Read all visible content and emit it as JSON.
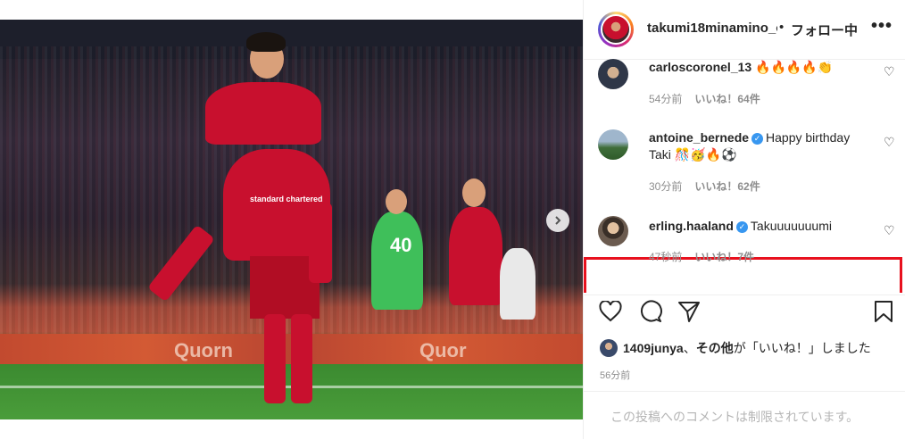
{
  "post": {
    "author": "takumi18minamino_o",
    "separator": "•",
    "follow_label": "フォロー中",
    "more_label": "•••",
    "photo": {
      "board_text_1": "Quorn",
      "board_text_2": "Quor",
      "sponsor_text": "standard chartered",
      "jersey_number": "40"
    }
  },
  "comments": [
    {
      "username": "carloscoronel_13",
      "verified": false,
      "text": "🔥🔥🔥🔥👏",
      "time": "54分前",
      "likes": "いいね！64件"
    },
    {
      "username": "antoine_bernede",
      "verified": true,
      "text": "Happy birthday Taki 🎊🥳🔥⚽",
      "time": "30分前",
      "likes": "いいね！62件"
    },
    {
      "username": "erling.haaland",
      "verified": true,
      "text": "Takuuuuuuumi",
      "time": "47秒前",
      "likes": "いいね！7件"
    }
  ],
  "likes_summary": {
    "user": "1409junya",
    "joiner": "、",
    "others": "その他",
    "suffix": "が「いいね！」しました"
  },
  "timestamp": "56分前",
  "comment_input": {
    "disabled_text": "この投稿へのコメントは制限されています。"
  },
  "icons": [
    "heart-icon",
    "comment-icon",
    "share-icon",
    "bookmark-icon",
    "chevron-right-icon",
    "verified-icon"
  ],
  "colors": {
    "highlight_border": "#e8111e",
    "verified": "#3897f0",
    "liverpool_red": "#c8102e"
  }
}
